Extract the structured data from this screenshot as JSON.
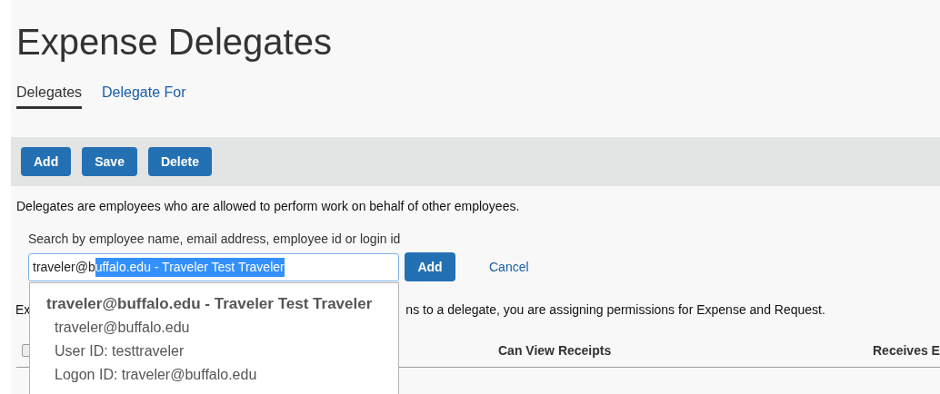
{
  "page_title": "Expense Delegates",
  "tabs": [
    {
      "label": "Delegates",
      "selected": true
    },
    {
      "label": "Delegate For",
      "selected": false
    }
  ],
  "toolbar_buttons": [
    "Add",
    "Save",
    "Delete"
  ],
  "description": "Delegates are employees who are allowed to perform work on behalf of other employees.",
  "search": {
    "label": "Search by employee name, email address, employee id or login id",
    "value": "traveler@b",
    "selected_value": "uffalo.edu - Traveler Test Traveler",
    "add_button": "Add",
    "cancel_link": "Cancel"
  },
  "suggestion": {
    "title": "traveler@buffalo.edu - Traveler Test Traveler",
    "lines": [
      "traveler@buffalo.edu",
      "User ID: testtraveler",
      "Logon ID: traveler@buffalo.edu"
    ]
  },
  "info_text": {
    "start": "Ex",
    "end": "ns to a delegate, you are assigning permissions for Expense and Request."
  },
  "table": {
    "select_all": {
      "checked": false
    },
    "columns": [
      "Can View Receipts",
      "Receives E"
    ]
  }
}
